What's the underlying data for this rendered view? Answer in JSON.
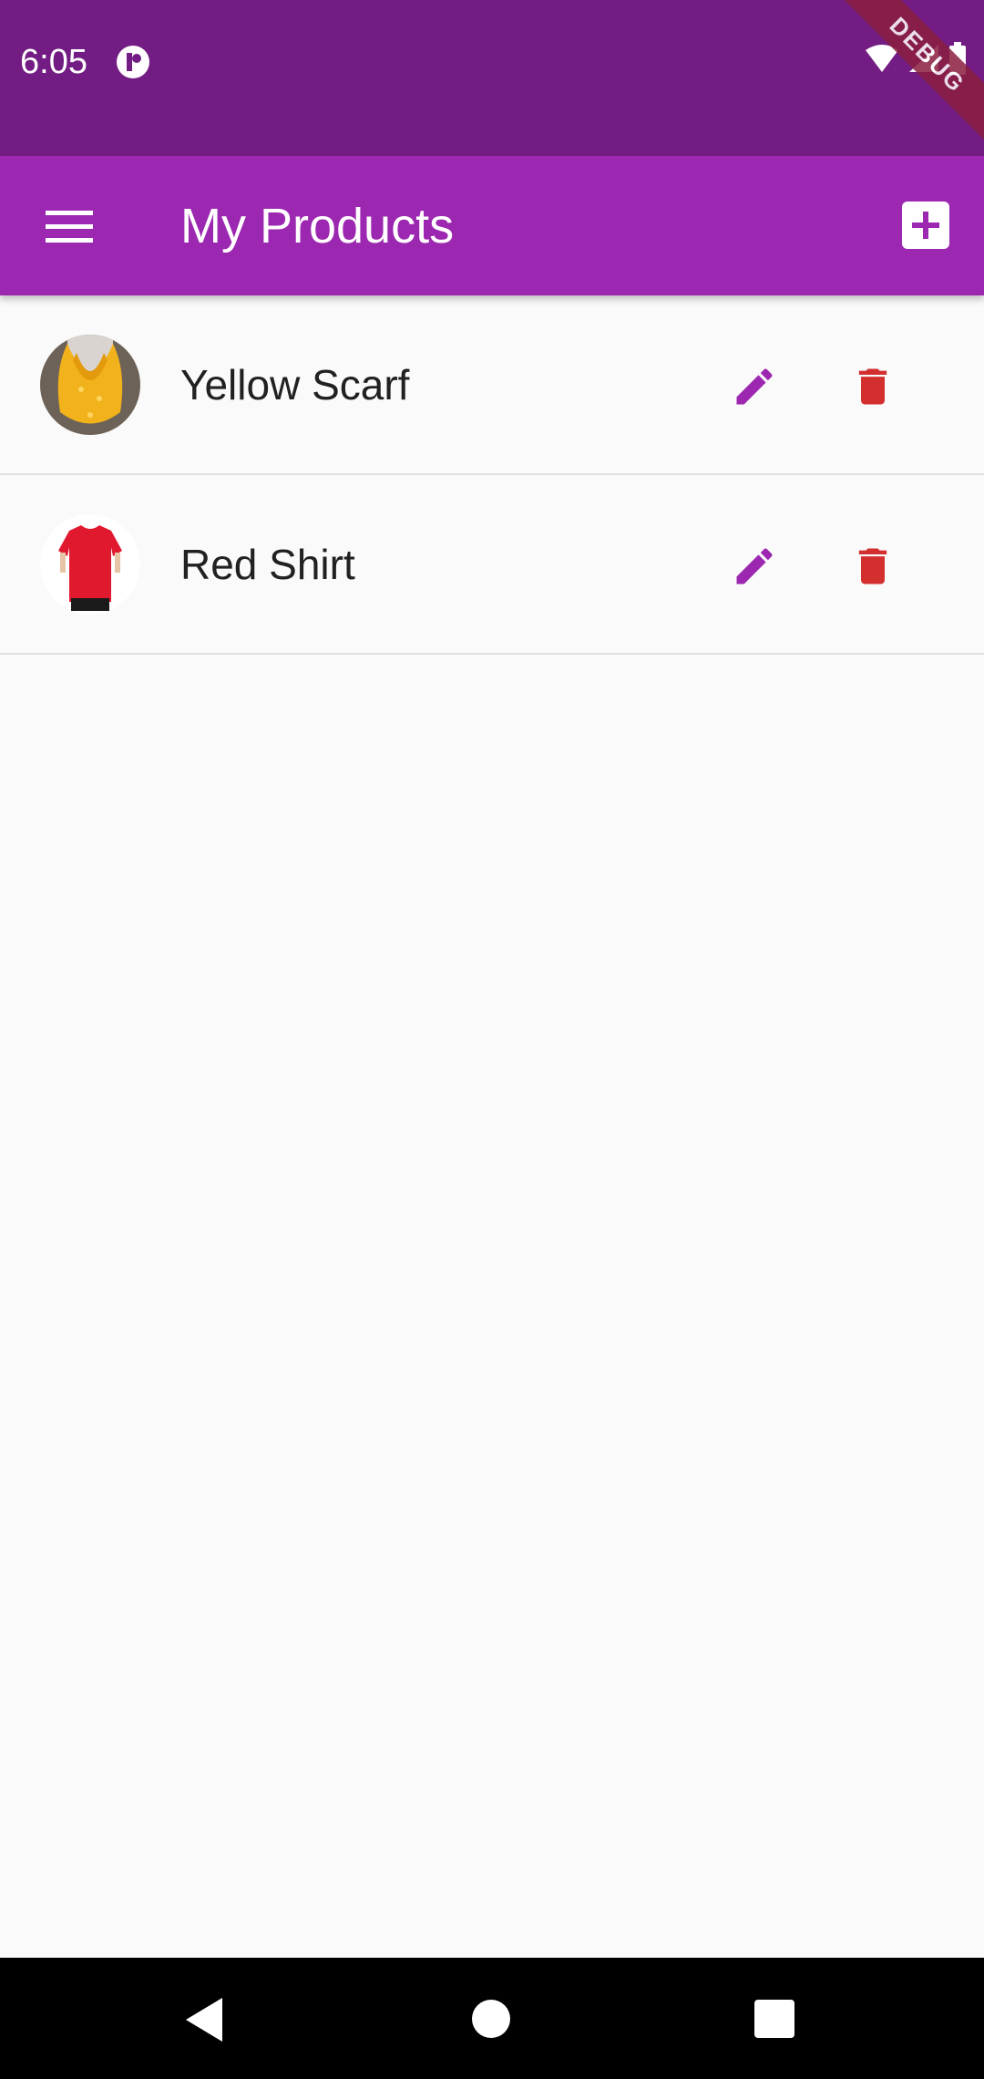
{
  "status_bar": {
    "time": "6:05",
    "debug_label": "DEBUG"
  },
  "app_bar": {
    "title": "My Products",
    "menu_icon": "menu-icon",
    "add_icon": "add-box-icon"
  },
  "products": [
    {
      "title": "Yellow Scarf",
      "image": "yellow-scarf-thumbnail"
    },
    {
      "title": "Red Shirt",
      "image": "red-shirt-thumbnail"
    }
  ],
  "colors": {
    "status_bar": "#731d84",
    "primary": "#9c27b0",
    "edit_icon": "#9c27b0",
    "delete_icon": "#d32f2f",
    "background": "#fafafa"
  },
  "nav": {
    "back_icon": "back-icon",
    "home_icon": "home-icon",
    "recents_icon": "recents-icon"
  }
}
